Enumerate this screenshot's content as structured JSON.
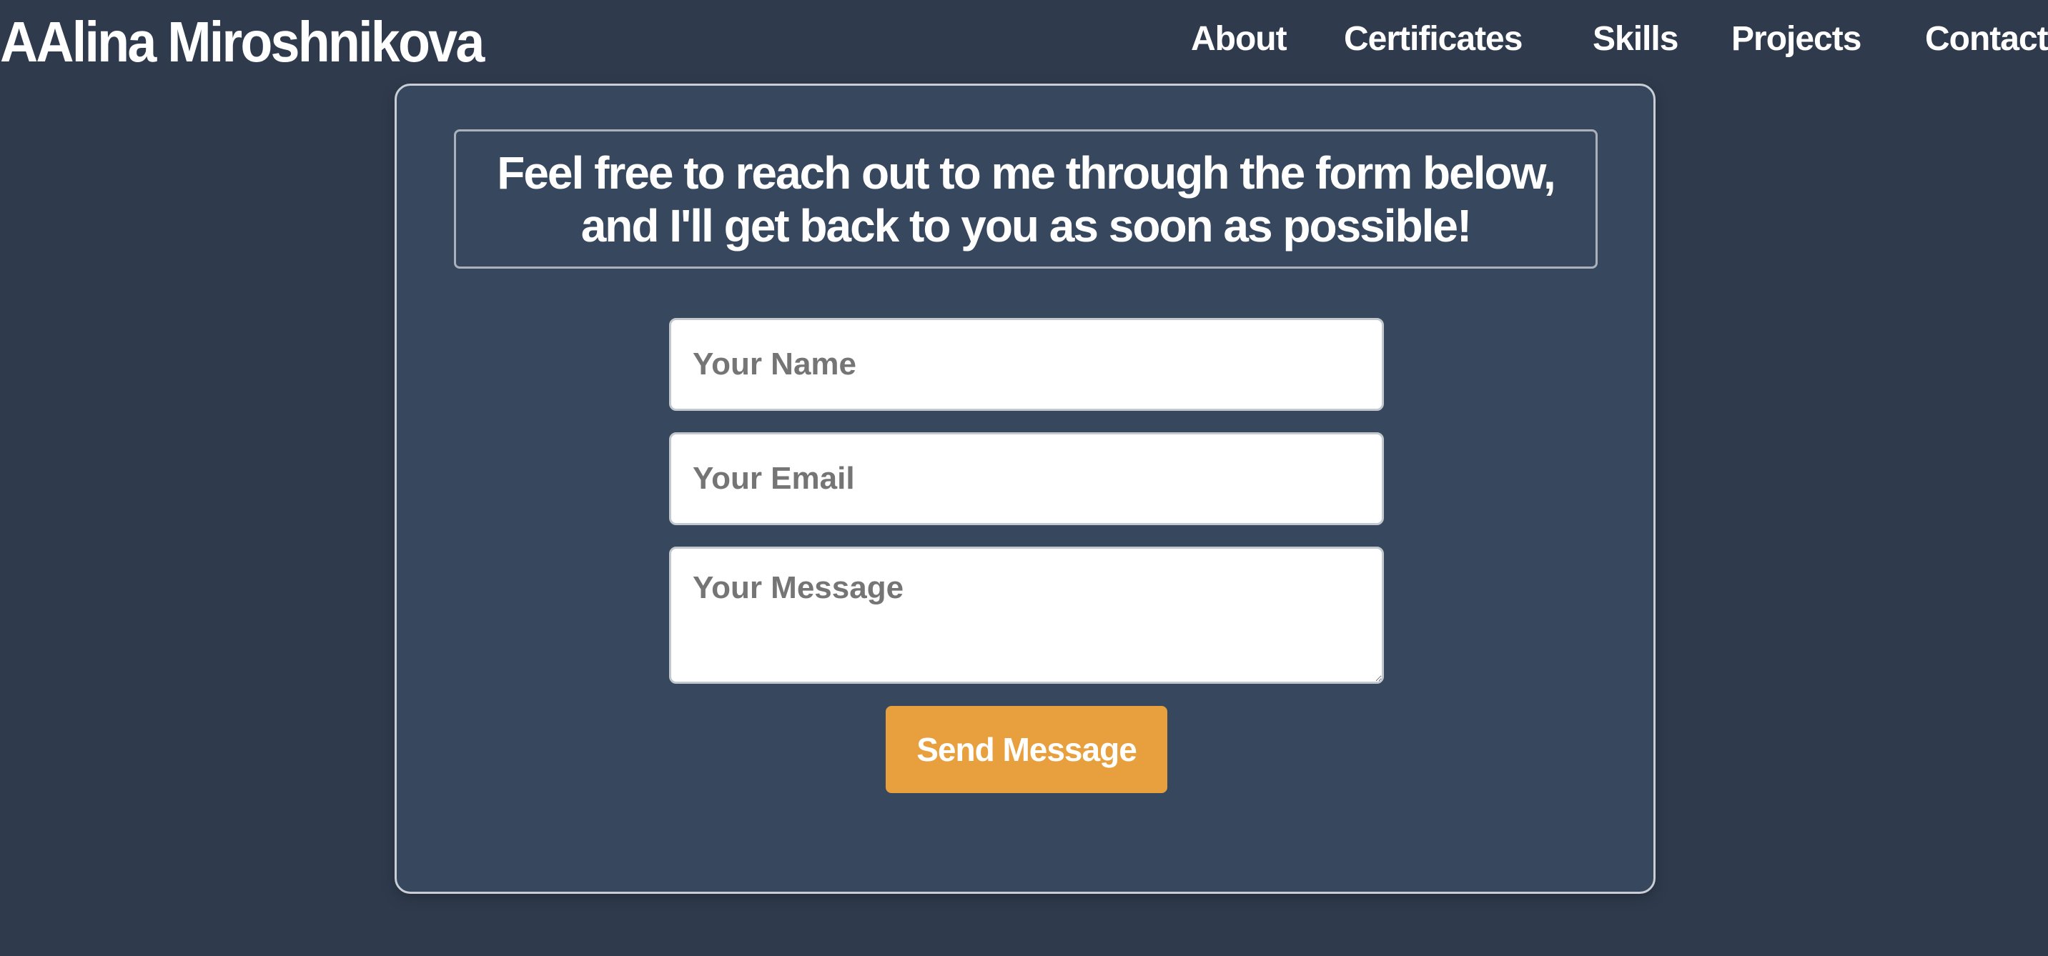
{
  "header": {
    "site_title": "AAlina Miroshnikova",
    "nav": {
      "about": "About",
      "certificates": "Certificates",
      "skills": "Skills",
      "projects": "Projects",
      "contact": "Contact"
    }
  },
  "contact": {
    "intro_line1": "Feel free to reach out to me through the form below,",
    "intro_line2": "and I'll get back to you as soon as possible!",
    "name_placeholder": "Your Name",
    "email_placeholder": "Your Email",
    "message_placeholder": "Your Message",
    "send_label": "Send Message"
  },
  "colors": {
    "page_background": "#2f3b4d",
    "card_background": "#37485e",
    "accent_button": "#e8a03e",
    "text": "#ffffff"
  }
}
